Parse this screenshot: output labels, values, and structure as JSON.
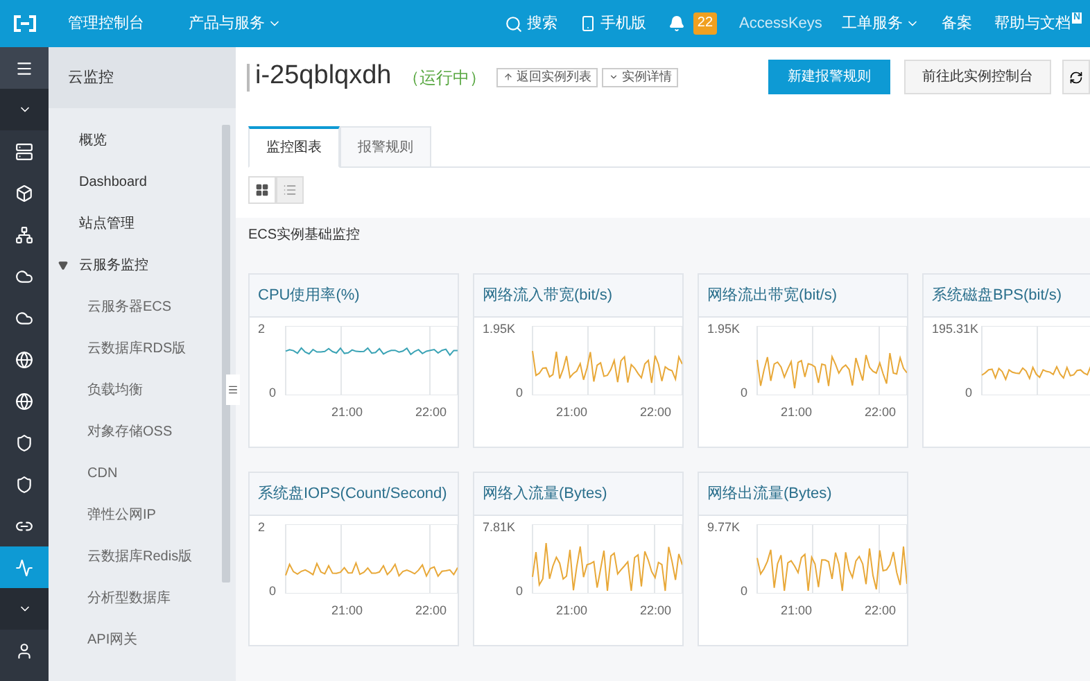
{
  "top_bar": {
    "left_links": [
      "管理控制台",
      "产品与服务"
    ],
    "search": "搜索",
    "mobile": "手机版",
    "notifications": "22",
    "access_keys": "AccessKeys",
    "tickets": "工单服务",
    "filing": "备案",
    "help": "帮助与文档",
    "help_badge": "N"
  },
  "rail": [
    {
      "kind": "menu",
      "selected": false
    },
    {
      "kind": "caret",
      "selected": false
    },
    {
      "kind": "server",
      "selected": false
    },
    {
      "kind": "box",
      "selected": false
    },
    {
      "kind": "network",
      "selected": false
    },
    {
      "kind": "cloud",
      "selected": false
    },
    {
      "kind": "cloud",
      "selected": false
    },
    {
      "kind": "globe",
      "selected": false
    },
    {
      "kind": "globe",
      "selected": false
    },
    {
      "kind": "shield",
      "selected": false
    },
    {
      "kind": "shield",
      "selected": false
    },
    {
      "kind": "link",
      "selected": false
    },
    {
      "kind": "monitor",
      "selected": true
    },
    {
      "kind": "caret",
      "selected": false
    },
    {
      "kind": "user",
      "selected": false
    }
  ],
  "sidebar": {
    "title": "云监控",
    "items": [
      {
        "label": "概览",
        "selected": false
      },
      {
        "label": "Dashboard",
        "selected": false
      },
      {
        "label": "站点管理",
        "selected": false
      },
      {
        "label": "云服务监控",
        "selected": false,
        "expanded": true,
        "children": [
          {
            "label": "云服务器ECS",
            "selected": false
          },
          {
            "label": "云数据库RDS版",
            "selected": false
          },
          {
            "label": "负载均衡",
            "selected": false
          },
          {
            "label": "对象存储OSS",
            "selected": false
          },
          {
            "label": "CDN",
            "selected": false
          },
          {
            "label": "弹性公网IP",
            "selected": false
          },
          {
            "label": "云数据库Redis版",
            "selected": false
          },
          {
            "label": "分析型数据库",
            "selected": false
          },
          {
            "label": "API网关",
            "selected": false
          }
        ]
      }
    ]
  },
  "header": {
    "instance": "i-25qblqxdh",
    "status": "（运行中）",
    "back_button": "返回实例列表",
    "details_button": "实例详情",
    "primary_button": "新建报警规则",
    "console_button": "前往此实例控制台"
  },
  "tabs": [
    {
      "label": "监控图表",
      "selected": true
    },
    {
      "label": "报警规则",
      "selected": false
    }
  ],
  "view_toggle": [
    {
      "kind": "grid",
      "selected": true
    },
    {
      "kind": "list",
      "selected": false
    }
  ],
  "section_title": "ECS实例基础监控",
  "charts": [
    {
      "title": "CPU使用率(%)",
      "y_max": "2",
      "y_min": "0",
      "x_labels": [
        "21:00",
        "22:00"
      ],
      "color": "#3aa3b5"
    },
    {
      "title": "网络流入带宽(bit/s)",
      "y_max": "1.95K",
      "y_min": "0",
      "x_labels": [
        "21:00",
        "22:00"
      ],
      "color": "#e8a838"
    },
    {
      "title": "网络流出带宽(bit/s)",
      "y_max": "1.95K",
      "y_min": "0",
      "x_labels": [
        "21:00",
        "22:00"
      ],
      "color": "#e8a838"
    },
    {
      "title": "系统磁盘BPS(bit/s)",
      "y_max": "195.31K",
      "y_min": "0",
      "color": "#e8a838"
    },
    {
      "title": "系统盘IOPS(Count/Second)",
      "y_max": "2",
      "y_min": "0",
      "x_labels": [
        "21:00",
        "22:00"
      ],
      "color": "#e8a838"
    },
    {
      "title": "网络入流量(Bytes)",
      "y_max": "7.81K",
      "y_min": "0",
      "x_labels": [
        "21:00",
        "22:00"
      ],
      "color": "#e8a838"
    },
    {
      "title": "网络出流量(Bytes)",
      "y_max": "9.77K",
      "y_min": "0",
      "x_labels": [
        "21:00",
        "22:00"
      ],
      "color": "#e8a838"
    }
  ]
}
